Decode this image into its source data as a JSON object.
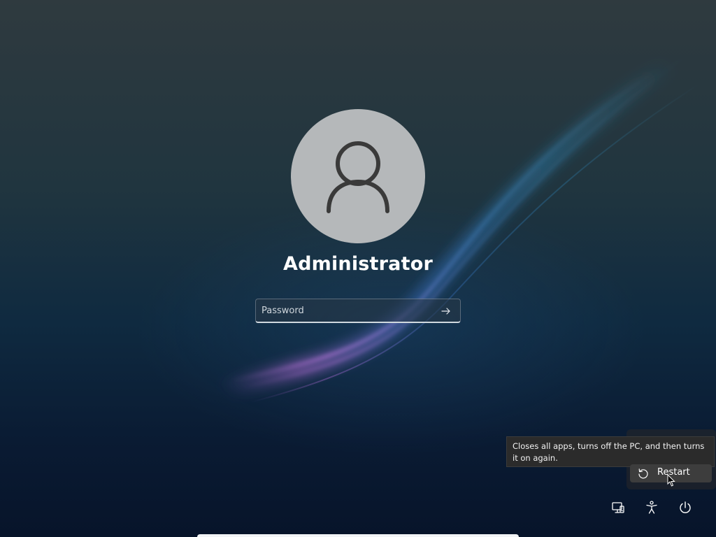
{
  "user": {
    "name": "Administrator",
    "avatar_icon": "person-icon"
  },
  "password": {
    "placeholder": "Password",
    "value": "",
    "submit_icon": "arrow-right-icon"
  },
  "power_menu": {
    "tooltip": "Closes all apps, turns off the PC, and then turns it on again.",
    "restart_label": "Restart",
    "restart_icon": "restart-icon"
  },
  "tray": {
    "network_icon": "network-icon",
    "accessibility_icon": "accessibility-icon",
    "power_icon": "power-icon"
  },
  "colors": {
    "avatar_bg": "#b5b8ba",
    "text": "#ffffff",
    "tooltip_bg": "#2b2b2b"
  }
}
